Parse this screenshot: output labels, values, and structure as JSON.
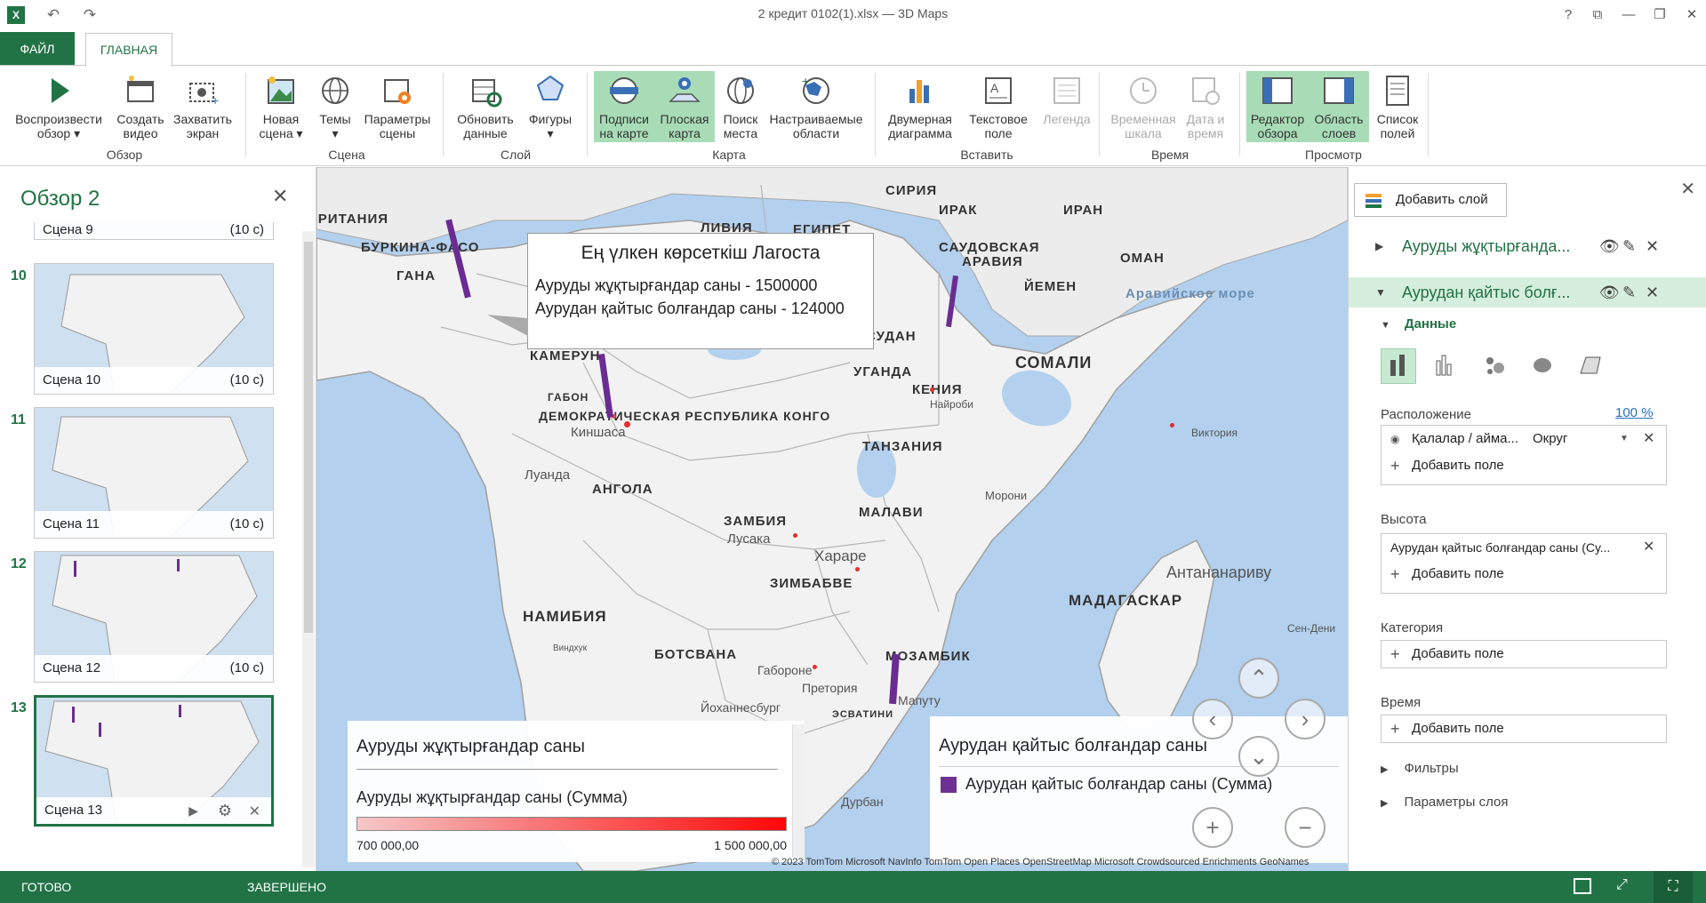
{
  "window": {
    "title": "2 кредит 0102(1).xlsx — 3D Maps",
    "help": "?"
  },
  "tabs": {
    "file": "ФАЙЛ",
    "home": "ГЛАВНАЯ"
  },
  "ribbon": {
    "groups": {
      "tour": "Обзор",
      "scene": "Сцена",
      "layer": "Слой",
      "map": "Карта",
      "insert": "Вставить",
      "time": "Время",
      "view": "Просмотр"
    },
    "buttons": {
      "play_tour": [
        "Воспроизвести",
        "обзор ▾"
      ],
      "create_video": [
        "Создать",
        "видео"
      ],
      "capture_screen": [
        "Захватить",
        "экран"
      ],
      "new_scene": [
        "Новая",
        "сцена ▾"
      ],
      "themes": [
        "Темы",
        "▾"
      ],
      "scene_options": [
        "Параметры",
        "сцены"
      ],
      "refresh_data": [
        "Обновить",
        "данные"
      ],
      "shapes": [
        "Фигуры",
        "▾"
      ],
      "map_labels": [
        "Подписи",
        "на карте"
      ],
      "flat_map": [
        "Плоская",
        "карта"
      ],
      "find_location": [
        "Поиск",
        "места"
      ],
      "custom_regions": [
        "Настраиваемые",
        "области"
      ],
      "chart_2d": [
        "Двумерная",
        "диаграмма"
      ],
      "text_box": [
        "Текстовое",
        "поле"
      ],
      "legend": [
        "Легенда",
        ""
      ],
      "timeline": [
        "Временная",
        "шкала"
      ],
      "date_time": [
        "Дата и",
        "время"
      ],
      "tour_editor": [
        "Редактор",
        "обзора"
      ],
      "layer_pane": [
        "Область",
        "слоев"
      ],
      "field_list": [
        "Список",
        "полей"
      ]
    }
  },
  "tour_panel": {
    "title": "Обзор 2",
    "partial_scene": {
      "name": "Сцена 9",
      "duration": "(10 с)"
    },
    "scenes": [
      {
        "number": "10",
        "name": "Сцена 10",
        "duration": "(10 с)"
      },
      {
        "number": "11",
        "name": "Сцена 11",
        "duration": "(10 с)"
      },
      {
        "number": "12",
        "name": "Сцена 12",
        "duration": "(10 с)"
      },
      {
        "number": "13",
        "name": "Сцена 13",
        "duration": ""
      }
    ]
  },
  "map": {
    "countries": [
      "БРИТАНИЯ",
      "БУРКИНА-ФАСО",
      "ГАНА",
      "ЛИВИЯ",
      "ЕГИПЕТ",
      "СИРИЯ",
      "ИРАК",
      "ИРАН",
      "САУДОВСКАЯ",
      "АРАВИЯ",
      "ОМАН",
      "ЙЕМЕН",
      "СУДАН",
      "КАМЕРУН",
      "ГАБОН",
      "ДЕМОКРАТИЧЕСКАЯ РЕСПУБЛИКА КОНГО",
      "УГАНДА",
      "КЕНИЯ",
      "СОМАЛИ",
      "ТАНЗАНИЯ",
      "АНГОЛА",
      "ЗАМБИЯ",
      "МАЛАВИ",
      "ЗИМБАБВЕ",
      "НАМИБИЯ",
      "БОТСВАНА",
      "МОЗАМБИК",
      "МАДАГАСКАР",
      "ЭСВАТИНИ"
    ],
    "cities": [
      "Киншаса",
      "Луанда",
      "Найроби",
      "Виктория",
      "Морони",
      "Лусака",
      "Хараре",
      "Антананариву",
      "Габороне",
      "Претория",
      "Йоханнесбург",
      "Мапуту",
      "Дурбан",
      "Виндхук",
      "Сен-Дени"
    ],
    "sea": "Аравийское море",
    "attribution": "© 2023 TomTom   Microsoft   NavInfo   TomTom   Open Places   OpenStreetMap   Microsoft Crowdsourced Enrichments   GeoNames"
  },
  "tooltip": {
    "title": "Ең үлкен көрсеткіш Лагоста",
    "line1": "Ауруды жұқтырғандар саны - 1500000",
    "line2": "Аурудан қайтыс болғандар саны - 124000"
  },
  "legend_heat": {
    "title": "Ауруды жұқтырғандар саны",
    "subtitle": "Ауруды жұқтырғандар саны (Сумма)",
    "min": "700 000,00",
    "max": "1 500 000,00",
    "gradient_start": "#f8c8c8",
    "gradient_end": "#ff0000"
  },
  "legend_bar": {
    "title": "Аурудан қайтыс болғандар саны",
    "item": "Аурудан қайтыс болғандар саны (Сумма)",
    "color": "#6a2c91"
  },
  "layer_pane": {
    "add_layer": "Добавить слой",
    "layers": [
      "Ауруды жұқтырғанда...",
      "Аурудан қайтыс болғ..."
    ],
    "data_header": "Данные",
    "location_label": "Расположение",
    "location_percent": "100 %",
    "location_field": "Қалалар / айма...",
    "location_type": "Округ",
    "add_field": "Добавить поле",
    "height_label": "Высота",
    "height_field": "Аурудан қайтыс болғандар саны (Су...",
    "category_label": "Категория",
    "time_label": "Время",
    "filters": "Фильтры",
    "layer_options": "Параметры слоя"
  },
  "status": {
    "ready": "ГОТОВО",
    "complete": "ЗАВЕРШЕНО"
  },
  "colors": {
    "accent": "#217346",
    "bar": "#6a2c91",
    "heat": "#ff0000"
  }
}
